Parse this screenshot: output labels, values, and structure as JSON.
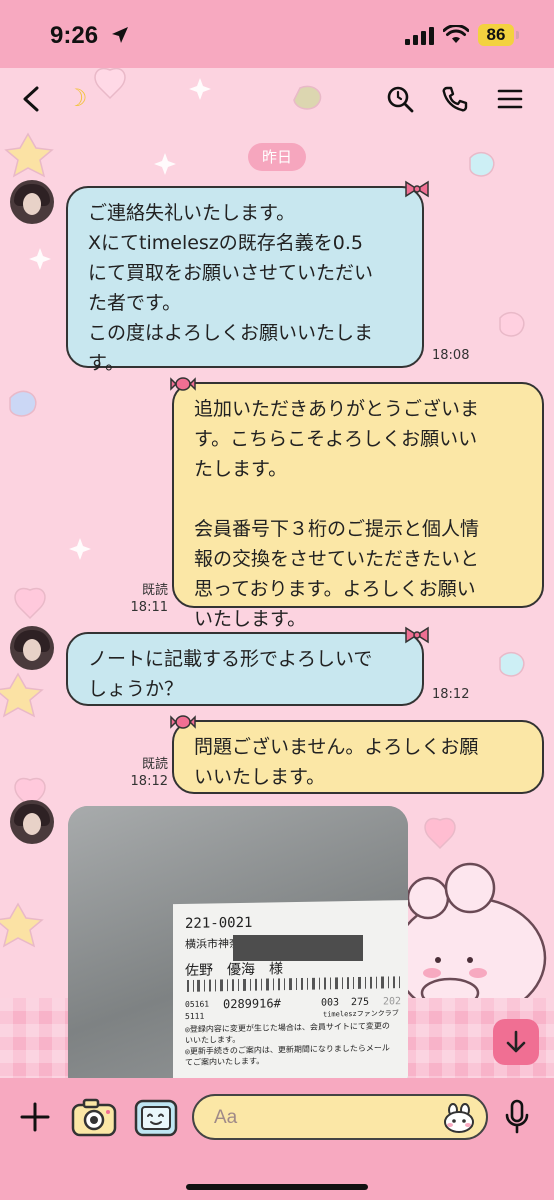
{
  "status_bar": {
    "time": "9:26",
    "battery": "86"
  },
  "header": {
    "title_icon": "moon-emoji"
  },
  "date_divider": "昨日",
  "messages": [
    {
      "side": "in",
      "text": "ご連絡失礼いたします。\nXにてtimeleszの既存名義を0.5\nにて買取をお願いさせていただい\nた者です。\nこの度はよろしくお願いいたしま\nす。",
      "time": "18:08"
    },
    {
      "side": "out",
      "text": "追加いただきありがとうございま\nす。こちらこそよろしくお願いい\nたします。\n\n会員番号下３桁のご提示と個人情\n報の交換をさせていただきたいと\n思っております。よろしくお願い\nいたします。",
      "read": "既読",
      "time": "18:11"
    },
    {
      "side": "in",
      "text": "ノートに記載する形でよろしいで\nしょうか？",
      "time": "18:12"
    },
    {
      "side": "out",
      "text": "問題ございません。よろしくお願\nいいたします。",
      "read": "既読",
      "time": "18:12"
    }
  ],
  "photo_card": {
    "postal": "221-0021",
    "address": "横浜市神奈川区",
    "name": "佐野　優海　様",
    "code_a": "05161",
    "member": "0289916#",
    "code_b": "5111",
    "code_c": "003",
    "code_d": "275",
    "year": "202",
    "club": "timeleszファンクラブ",
    "note1": "◎登録内容に変更が生じた場合は、会員サイトにて変更の",
    "note2": "いいたします。",
    "note3": "◎更新手続きのご案内は、更新期間になりましたらメール",
    "note4": "てご案内いたします。"
  },
  "input": {
    "placeholder": "Aa"
  },
  "colors": {
    "pink_bar": "#f7a9c0",
    "incoming_bubble": "#c8e7ef",
    "outgoing_bubble": "#fbe7a6",
    "accent": "#f06f93"
  }
}
